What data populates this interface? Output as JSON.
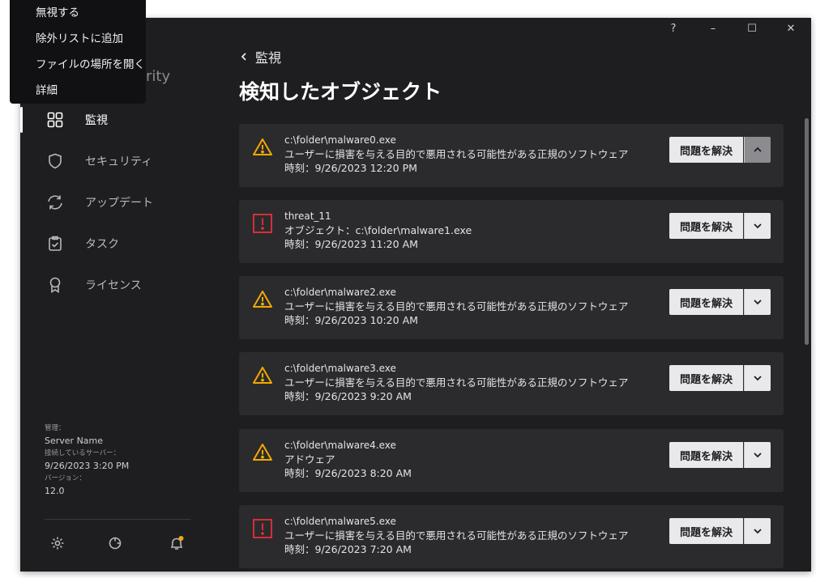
{
  "app": {
    "brand_suffix": "rity"
  },
  "context_menu": {
    "items": [
      "無視する",
      "除外リストに追加",
      "ファイルの場所を開く",
      "詳細"
    ]
  },
  "window_controls": {
    "help": "?",
    "minimize": "–",
    "maximize": "☐",
    "close": "✕"
  },
  "sidebar": {
    "items": [
      {
        "label": "監視",
        "icon": "dashboard-icon",
        "active": true
      },
      {
        "label": "セキュリティ",
        "icon": "shield-icon",
        "active": false
      },
      {
        "label": "アップデート",
        "icon": "update-icon",
        "active": false
      },
      {
        "label": "タスク",
        "icon": "task-icon",
        "active": false
      },
      {
        "label": "ライセンス",
        "icon": "license-icon",
        "active": false
      }
    ],
    "info": {
      "managed_label": "管理：",
      "server_name": "Server Name",
      "connected_label": "接続しているサーバー：",
      "connected_time": "9/26/2023 3:20 PM",
      "version_label": "バージョン：",
      "version": "12.0"
    },
    "bottom_icons": [
      "settings-icon",
      "support-icon",
      "notifications-icon"
    ]
  },
  "main": {
    "back_label": "監視",
    "title": "検知したオブジェクト",
    "resolve_label": "問題を解決",
    "cards": [
      {
        "severity": "warning",
        "line1": "c:\\folder\\malware0.exe",
        "line2": "ユーザーに損害を与える目的で悪用される可能性がある正規のソフトウェア",
        "line3": "時刻：9/26/2023 12:20 PM",
        "expanded": true
      },
      {
        "severity": "critical",
        "line1": "threat_11",
        "line2": "オブジェクト：c:\\folder\\malware1.exe",
        "line3": "時刻：9/26/2023 11:20 AM",
        "expanded": false
      },
      {
        "severity": "warning",
        "line1": "c:\\folder\\malware2.exe",
        "line2": "ユーザーに損害を与える目的で悪用される可能性がある正規のソフトウェア",
        "line3": "時刻：9/26/2023 10:20 AM",
        "expanded": false
      },
      {
        "severity": "warning",
        "line1": "c:\\folder\\malware3.exe",
        "line2": "ユーザーに損害を与える目的で悪用される可能性がある正規のソフトウェア",
        "line3": "時刻：9/26/2023 9:20 AM",
        "expanded": false
      },
      {
        "severity": "warning",
        "line1": "c:\\folder\\malware4.exe",
        "line2": "アドウェア",
        "line3": "時刻：9/26/2023 8:20 AM",
        "expanded": false
      },
      {
        "severity": "critical",
        "line1": "c:\\folder\\malware5.exe",
        "line2": "ユーザーに損害を与える目的で悪用される可能性がある正規のソフトウェア",
        "line3": "時刻：9/26/2023 7:20 AM",
        "expanded": false
      }
    ]
  },
  "colors": {
    "warning": "#f2a900",
    "critical": "#e8303a",
    "accent_dot": "#f2a900"
  }
}
